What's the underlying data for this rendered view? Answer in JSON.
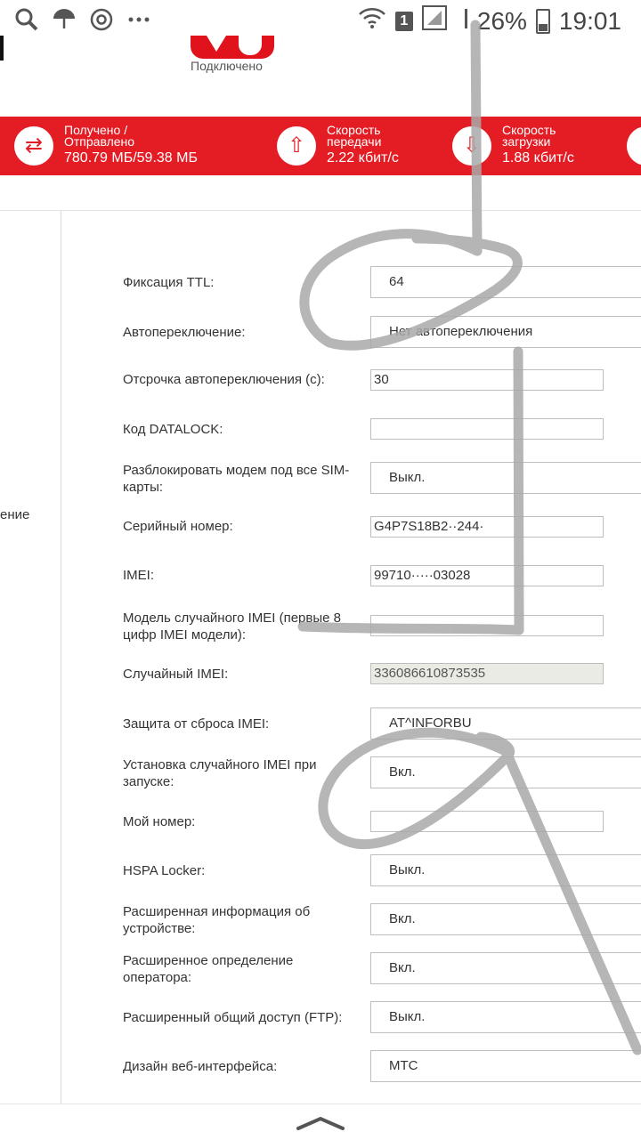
{
  "status_bar": {
    "left_icons": [
      "search-icon",
      "umbrella-icon",
      "at-icon",
      "more-icon"
    ],
    "sim_badge": "1",
    "battery": "26%",
    "time": "19:01"
  },
  "header": {
    "connection_status": "Подключено"
  },
  "stats": [
    {
      "label_line1": "Получено /",
      "label_line2": "Отправлено",
      "value": "780.79 МБ/59.38 МБ",
      "icon": "swap-arrows-icon"
    },
    {
      "label_line1": "Скорость",
      "label_line2": "передачи",
      "value": "2.22 кбит/с",
      "icon": "upload-arrow-icon"
    },
    {
      "label_line1": "Скорость",
      "label_line2": "загрузки",
      "value": "1.88 кбит/с",
      "icon": "download-arrow-icon"
    }
  ],
  "sidebar": {
    "partial_label": "ение"
  },
  "settings": [
    {
      "label": "Фиксация TTL:",
      "value": "64"
    },
    {
      "label": "Автопереключение:",
      "value": "Нет автопереключения"
    },
    {
      "label": "Отсрочка автопереключения (с):",
      "value": "30"
    },
    {
      "label": "Код DATALOCK:",
      "value": ""
    },
    {
      "label": "Разблокировать модем под все SIM-карты:",
      "value": "Выкл."
    },
    {
      "label": "Серийный номер:",
      "value": "G4P7S18B2··244·"
    },
    {
      "label": "IMEI:",
      "value": "99710·····03028"
    },
    {
      "label": "Модель случайного IMEI (первые 8 цифр IMEI модели):",
      "value": ""
    },
    {
      "label": "Случайный IMEI:",
      "value": "336086610873535"
    },
    {
      "label": "Защита от сброса IMEI:",
      "value": "AT^INFORBU"
    },
    {
      "label": "Установка случайного IMEI при запуске:",
      "value": "Вкл."
    },
    {
      "label": "Мой номер:",
      "value": ""
    },
    {
      "label": "HSPA Locker:",
      "value": "Выкл."
    },
    {
      "label": "Расширенная информация об устройстве:",
      "value": "Вкл."
    },
    {
      "label": "Расширенное определение оператора:",
      "value": "Вкл."
    },
    {
      "label": "Расширенный общий доступ (FTP):",
      "value": "Выкл."
    },
    {
      "label": "Дизайн веб-интерфейса:",
      "value": "МТС"
    }
  ],
  "colors": {
    "accent": "#e41d25"
  }
}
